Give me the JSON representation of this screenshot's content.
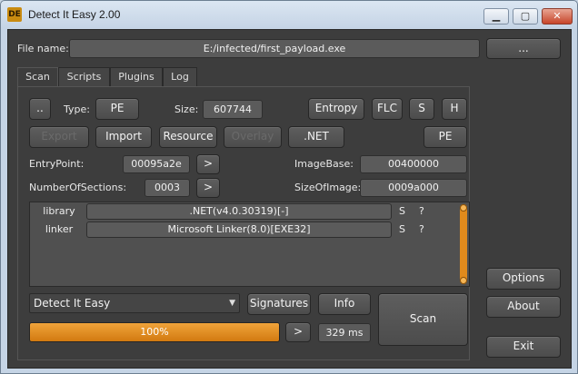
{
  "window": {
    "title": "Detect It Easy 2.00",
    "icon_text": "DE",
    "min": "▁",
    "max": "▢",
    "close": "✕"
  },
  "file": {
    "label": "File name:",
    "path": "E:/infected/first_payload.exe",
    "browse": "..."
  },
  "tabs": [
    {
      "label": "Scan",
      "active": true
    },
    {
      "label": "Scripts"
    },
    {
      "label": "Plugins"
    },
    {
      "label": "Log"
    }
  ],
  "row1": {
    "up": "..",
    "type_label": "Type:",
    "type": "PE",
    "size_label": "Size:",
    "size": "607744",
    "entropy": "Entropy",
    "flc": "FLC",
    "s": "S",
    "h": "H"
  },
  "row2": {
    "export": "Export",
    "import": "Import",
    "resource": "Resource",
    "overlay": "Overlay",
    "net": ".NET",
    "pe": "PE"
  },
  "info": {
    "entrypoint_label": "EntryPoint:",
    "entrypoint": "00095a2e",
    "entrypoint_go": ">",
    "imagebase_label": "ImageBase:",
    "imagebase": "00400000",
    "sections_label": "NumberOfSections:",
    "sections": "0003",
    "sections_go": ">",
    "sizeofimage_label": "SizeOfImage:",
    "sizeofimage": "0009a000"
  },
  "results": [
    {
      "type": "library",
      "value": ".NET(v4.0.30319)[-]",
      "s": "S",
      "q": "?"
    },
    {
      "type": "linker",
      "value": "Microsoft Linker(8.0)[EXE32]",
      "s": "S",
      "q": "?"
    }
  ],
  "bottom": {
    "engine": "Detect It Easy",
    "signatures": "Signatures",
    "info": "Info",
    "scan": "Scan",
    "progress_pct": 100,
    "progress_text": "100%",
    "next": ">",
    "time": "329 ms"
  },
  "side": {
    "options": "Options",
    "about": "About",
    "exit": "Exit"
  },
  "colors": {
    "accent": "#e08a1c",
    "background": "#3d3d3d"
  }
}
